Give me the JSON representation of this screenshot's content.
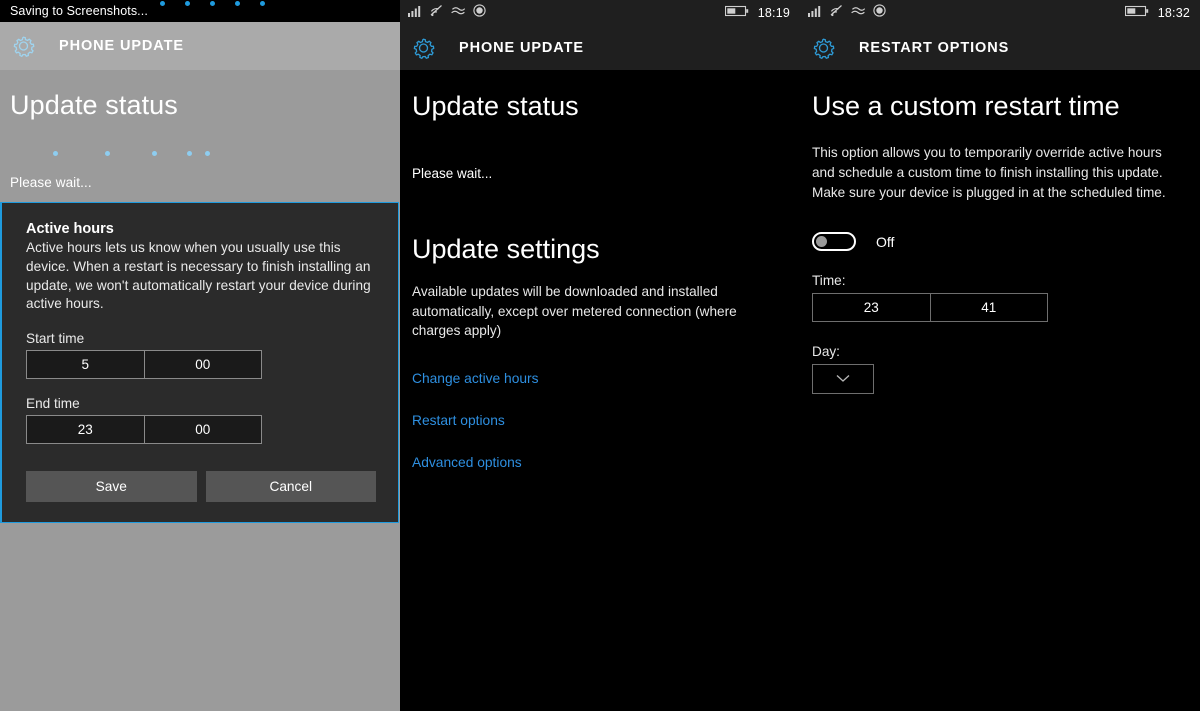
{
  "panel1": {
    "toast": {
      "text": "Saving to Screenshots...",
      "dots": 5,
      "dot_color": "#1f9bde"
    },
    "header": {
      "icon": "gear-icon",
      "title": "PHONE UPDATE"
    },
    "page_heading": "Update status",
    "status_text": "Please wait...",
    "progress_dots": 5,
    "dialog": {
      "title": "Active hours",
      "description": "Active hours lets us know when you usually use this device. When a restart is necessary to finish installing an update, we won't automatically restart your device during active hours.",
      "start_label": "Start time",
      "start_hour": "5",
      "start_minute": "00",
      "end_label": "End time",
      "end_hour": "23",
      "end_minute": "00",
      "save_label": "Save",
      "cancel_label": "Cancel",
      "accent_color": "#1f9bde"
    }
  },
  "panel2": {
    "statusbar": {
      "icons": [
        "signal-bars-icon",
        "wifi-icon",
        "airplane-waves-icon",
        "record-circle-icon"
      ],
      "battery_icon": "battery-half-icon",
      "time": "18:19"
    },
    "header": {
      "icon": "gear-icon",
      "title": "PHONE UPDATE"
    },
    "page_heading": "Update status",
    "status_text": "Please wait...",
    "settings_heading": "Update settings",
    "settings_description": "Available updates will be downloaded and installed automatically, except over metered connection (where charges apply)",
    "links": [
      "Change active hours",
      "Restart options",
      "Advanced options"
    ],
    "link_color": "#2e8fe0"
  },
  "panel3": {
    "statusbar": {
      "icons": [
        "signal-bars-icon",
        "wifi-icon",
        "airplane-waves-icon",
        "record-circle-icon"
      ],
      "battery_icon": "battery-half-icon",
      "time": "18:32"
    },
    "header": {
      "icon": "gear-icon",
      "title": "RESTART OPTIONS"
    },
    "page_heading": "Use a custom restart time",
    "description": "This option allows you to temporarily override active hours and schedule a custom time to finish installing this update. Make sure your device is plugged in at the scheduled time.",
    "toggle": {
      "state": "Off",
      "on": false
    },
    "time_label": "Time:",
    "time_hour": "23",
    "time_minute": "41",
    "day_label": "Day:",
    "day_value": "",
    "day_icon": "chevron-down-icon"
  }
}
